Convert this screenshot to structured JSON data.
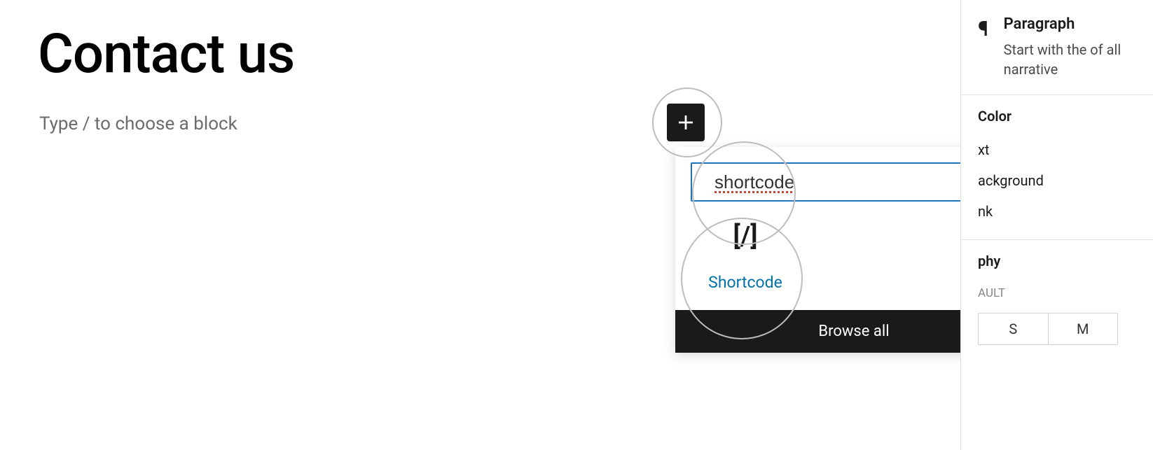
{
  "editor": {
    "title": "Contact us",
    "placeholder": "Type / to choose a block"
  },
  "inserter": {
    "search_value": "shortcode",
    "result": {
      "icon_text": "[/]",
      "label": "Shortcode"
    },
    "browse_all": "Browse all"
  },
  "sidebar": {
    "block": {
      "icon": "paragraph",
      "title": "Paragraph",
      "description": "Start with the of all narrative"
    },
    "sections": {
      "color": {
        "label": "Color",
        "rows": [
          "xt",
          "ackground",
          "nk"
        ]
      },
      "typography": {
        "label": "phy",
        "default": "AULT",
        "sizes": [
          "S",
          "M"
        ]
      }
    }
  }
}
